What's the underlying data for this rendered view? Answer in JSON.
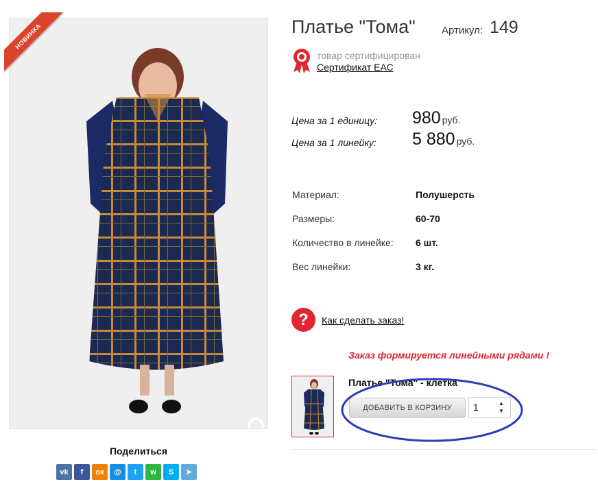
{
  "product": {
    "badge": "НОВИНКА",
    "title": "Платье \"Тома\"",
    "article_label": "Артикул:",
    "article_value": "149"
  },
  "certificate": {
    "text": "товар сертифицирован",
    "link": "Сертификат ЕАС"
  },
  "prices": [
    {
      "label": "Цена за 1 единицу:",
      "value": "980",
      "unit": "руб."
    },
    {
      "label": "Цена за 1 линейку:",
      "value": "5 880",
      "unit": "руб."
    }
  ],
  "specs": [
    {
      "label": "Материал:",
      "value": "Полушерсть"
    },
    {
      "label": "Размеры:",
      "value": "60-70"
    },
    {
      "label": "Количество в линейке:",
      "value": "6 шт."
    },
    {
      "label": "Вес линейки:",
      "value": "3 кг."
    }
  ],
  "help": {
    "icon": "?",
    "link": "Как сделать заказ!"
  },
  "order_note": "Заказ формируется линейными рядами !",
  "variant": {
    "title": "Платье \"Тома\" - клетка",
    "add_button": "ДОБАВИТЬ В КОРЗИНУ",
    "quantity": "1"
  },
  "share": {
    "label": "Поделиться",
    "buttons": [
      {
        "name": "vk",
        "glyph": "vk",
        "color": "#4c75a3"
      },
      {
        "name": "facebook",
        "glyph": "f",
        "color": "#3b5998"
      },
      {
        "name": "odnoklassniki",
        "glyph": "ок",
        "color": "#ee8208"
      },
      {
        "name": "moimir",
        "glyph": "@",
        "color": "#168de2"
      },
      {
        "name": "twitter",
        "glyph": "t",
        "color": "#1da1f2"
      },
      {
        "name": "whatsapp",
        "glyph": "w",
        "color": "#2cb742"
      },
      {
        "name": "skype",
        "glyph": "S",
        "color": "#00aff0"
      },
      {
        "name": "telegram",
        "glyph": "➤",
        "color": "#64a9dc"
      }
    ]
  },
  "colors": {
    "accent": "#e0262f",
    "badge": "#d9442b",
    "circle": "#2e3bb5"
  }
}
